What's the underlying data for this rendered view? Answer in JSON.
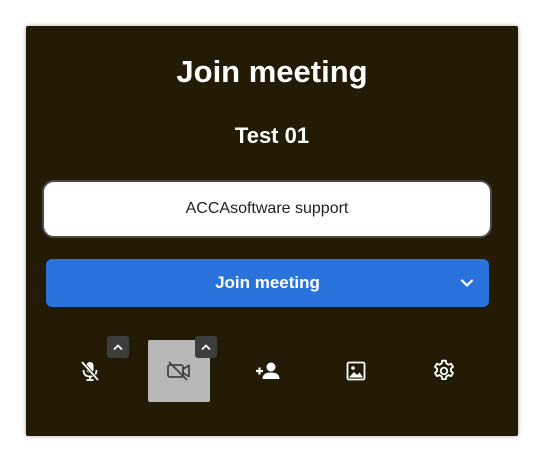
{
  "dialog": {
    "title": "Join meeting",
    "meeting_name": "Test 01",
    "name_input": {
      "value": "ACCAsoftware support",
      "placeholder": ""
    },
    "join_button": {
      "label": "Join meeting",
      "dropdown_icon": "chevron-down-icon"
    }
  },
  "toolbar": {
    "items": [
      {
        "icon": "microphone-off-icon",
        "has_options": true,
        "active": false
      },
      {
        "icon": "video-off-icon",
        "has_options": true,
        "active": true
      },
      {
        "icon": "invite-person-icon",
        "has_options": false,
        "active": false
      },
      {
        "icon": "background-image-icon",
        "has_options": false,
        "active": false
      },
      {
        "icon": "settings-gear-icon",
        "has_options": false,
        "active": false
      }
    ]
  },
  "colors": {
    "dialog_background": "#231b06",
    "primary_button": "#2a72dc",
    "active_toggle": "#b8b8b8",
    "badge": "#3d3d3d"
  }
}
